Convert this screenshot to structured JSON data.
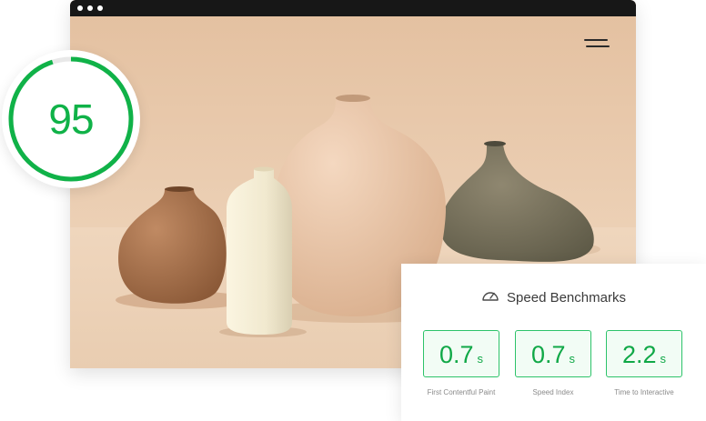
{
  "score": {
    "value": "95",
    "fraction": 0.95,
    "color": "#10b248"
  },
  "benchmarks": {
    "title": "Speed Benchmarks",
    "icon": "speedometer-icon",
    "metrics": [
      {
        "value": "0.7",
        "unit": "s",
        "label": "First Contentful Paint"
      },
      {
        "value": "0.7",
        "unit": "s",
        "label": "Speed Index"
      },
      {
        "value": "2.2",
        "unit": "s",
        "label": "Time to Interactive"
      }
    ]
  },
  "browser": {
    "menu_icon": "hamburger-menu-icon",
    "hero_image": "ceramic-vases-photo"
  },
  "colors": {
    "accent": "#10b248",
    "card_border": "#2dc36a",
    "titlebar": "#171717",
    "hero_background": "#e7c7aa"
  }
}
